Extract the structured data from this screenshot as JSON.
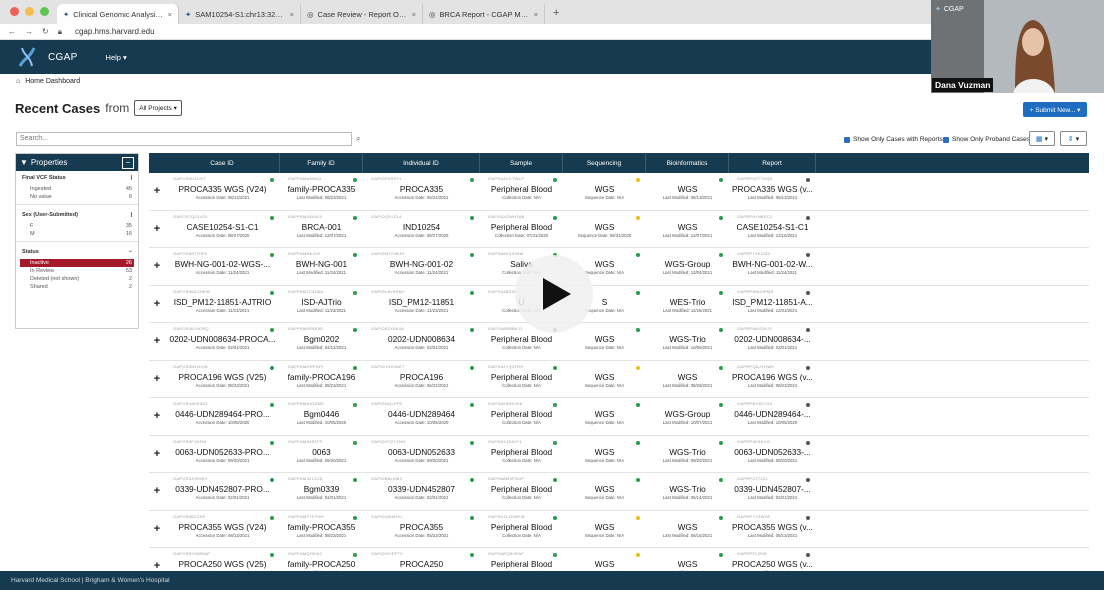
{
  "browser": {
    "tabs": [
      {
        "label": "Clinical Genomic Analysis Platf",
        "active": true
      },
      {
        "label": "SAM10254-S1:chr13:32316529"
      },
      {
        "label": "Case Review - Report Overview"
      },
      {
        "label": "BRCA Report - CGAP Mockup"
      }
    ],
    "url": "cgap.hms.harvard.edu"
  },
  "nav": {
    "brand": "CGAP",
    "help": "Help ▾"
  },
  "breadcrumb": "Home Dashboard",
  "header": {
    "title": "Recent Cases",
    "from": "from",
    "project_select": "All Projects ▾",
    "submit": "+ Submit New... ▾"
  },
  "search": {
    "placeholder": "Search..."
  },
  "options": {
    "reports": "Show Only Cases with Reports",
    "proband": "Show Only Proband Cases"
  },
  "facets": {
    "title": "Properties",
    "groups": [
      {
        "title": "Final VCF Status",
        "items": [
          {
            "label": "Ingested",
            "count": "45"
          },
          {
            "label": "No value",
            "count": "6"
          }
        ]
      },
      {
        "title": "Sex (User-Submitted)",
        "items": [
          {
            "label": "F",
            "count": "35"
          },
          {
            "label": "M",
            "count": "16"
          }
        ]
      },
      {
        "title": "Status",
        "items": [
          {
            "label": "Inactive",
            "count": "26",
            "selected": true
          },
          {
            "label": "In Review",
            "count": "53"
          },
          {
            "label": "Deleted (not shown)",
            "count": "2"
          },
          {
            "label": "Shared",
            "count": "2"
          }
        ]
      }
    ]
  },
  "table": {
    "columns": [
      "Case ID",
      "Family ID",
      "Individual ID",
      "Sample",
      "Sequencing",
      "Bioinformatics",
      "Report"
    ],
    "rows": [
      {
        "case": "PROCA335 WGS (V24)",
        "case_acc": "GAPCR6U1CZT",
        "case_date": "Accession Date: 08/13/2021",
        "family": "family-PROCA335",
        "fam_acc": "GAPFAMU0D6Q",
        "fam_date": "Last Modified: 08/23/2021",
        "ind": "PROCA335",
        "ind_acc": "GAPIDP4R9Y1",
        "ind_date": "Accession Date: 06/22/2021",
        "sample": "Peripheral Blood",
        "sample_acc": "GAPSA4VCTWLP",
        "sample_date": "Collection Date: N/A",
        "seq": "WGS",
        "seq_date": "Sequence Date: N/A",
        "bio": "WGS",
        "bio_date": "Last Modified: 08/13/2021",
        "report": "PROCA335 WGS (v...",
        "rep_acc": "GAPRP9ZT7UQ5",
        "rep_date": "Last Modified: 08/13/2021",
        "seq_dot": "#e8c21b"
      },
      {
        "case": "CASE10254-S1-C1",
        "case_acc": "GAPCR7QJ1XOI",
        "case_date": "Accession Date: 08/27/2020",
        "family": "BRCA-001",
        "fam_acc": "GAPFAM43K8L5",
        "fam_date": "Last Modified: 12/07/2021",
        "ind": "IND10254",
        "ind_acc": "GAPIDQ5YZL4",
        "ind_date": "Accession Date: 08/27/2020",
        "sample": "Peripheral Blood",
        "sample_acc": "GAPSAXZWHTAB",
        "sample_date": "Collection Date: 07/31/2020",
        "seq": "WGS",
        "seq_date": "Sequence Date: 08/31/2020",
        "bio": "WGS",
        "bio_date": "Last Modified: 12/07/2021",
        "report": "CASE10254-S1-C1",
        "rep_acc": "GAPRP6YN8PCZ",
        "rep_date": "Last Modified: 12/16/2021",
        "seq_dot": "#e8c21b"
      },
      {
        "case": "BWH-NG-001-02-WGS-...",
        "case_acc": "GAPCR8S77IRG",
        "case_date": "Accession Date: 11/24/2021",
        "family": "BWH-NG-001",
        "fam_acc": "GAPFAMRK3J9",
        "fam_date": "Last Modified: 11/24/2021",
        "ind": "BWH-NG-001-02",
        "ind_acc": "GAPIDN7Y3BJH",
        "ind_date": "Accession Date: 11/24/2021",
        "sample": "Saliva",
        "sample_acc": "GAPSA9VXZ94W",
        "sample_date": "Collection Date: N/A",
        "seq": "WGS",
        "seq_date": "Sequence Date: N/A",
        "bio": "WGS-Group",
        "bio_date": "Last Modified: 12/04/2021",
        "report": "BWH-NG-001-02-W...",
        "rep_acc": "GAPRPT4K2ZDI",
        "rep_date": "Last Modified: 11/24/2021",
        "seq_dot": "#2d9a4e"
      },
      {
        "case": "ISD_PM12-11851-AJTRIO",
        "case_acc": "GAPCR9ML2HKW",
        "case_date": "Accession Date: 11/23/2021",
        "family": "ISD-AJTrio",
        "fam_acc": "GAPFAM7C4D8A",
        "fam_date": "Last Modified: 11/23/2021",
        "ind": "ISD_PM12-11851",
        "ind_acc": "GAPIDL8V9RMY",
        "ind_date": "Accession Date: 11/23/2021",
        "sample": "U",
        "sample_acc": "GAPSA3BZ5CJ2",
        "sample_date": "Collection Date: N/A",
        "seq": "S",
        "seq_date": "Sequence Date: N/A",
        "bio": "WES-Trio",
        "bio_date": "Last Modified: 11/26/2021",
        "report": "ISD_PM12-11851-A...",
        "rep_acc": "GAPRP8NU5PMR",
        "rep_date": "Last Modified: 12/01/2021",
        "seq_dot": "#2d9a4e"
      },
      {
        "case": "0202-UDN008634-PROCA...",
        "case_acc": "GAPCR4KJ9CRQ",
        "case_date": "Accession Date: 02/01/2021",
        "family": "Bgm0202",
        "fam_acc": "GAPFAM0R9E8D",
        "fam_date": "Last Modified: 02/12/2021",
        "ind": "0202-UDN008634",
        "ind_acc": "GAPID5ZX9K4A",
        "ind_date": "Accession Date: 02/01/2021",
        "sample": "Peripheral Blood",
        "sample_acc": "GAPSA8RBBKJ1",
        "sample_date": "Collection Date: N/A",
        "seq": "WGS",
        "seq_date": "Sequence Date: N/A",
        "bio": "WGS-Trio",
        "bio_date": "Last Modified: 10/05/2021",
        "report": "0202-UDN008634-...",
        "rep_acc": "GAPRPMK0ZKJY",
        "rep_date": "Last Modified: 02/01/2021",
        "seq_dot": "#2d9a4e"
      },
      {
        "case": "PROCA196 WGS (V25)",
        "case_acc": "GAPCR5MHJOI8",
        "case_date": "Accession Date: 08/23/2021",
        "family": "family-PROCA196",
        "fam_acc": "GAPFAMHHPGFI",
        "fam_date": "Last Modified: 08/23/2021",
        "ind": "PROCA196",
        "ind_acc": "GAPIDY4V9AKT",
        "ind_date": "Accession Date: 06/22/2021",
        "sample": "Peripheral Blood",
        "sample_acc": "GAPSAJYQ3TH9",
        "sample_date": "Collection Date: N/A",
        "seq": "WGS",
        "seq_date": "Sequence Date: N/A",
        "bio": "WGS",
        "bio_date": "Last Modified: 08/28/2021",
        "report": "PROCA196 WGS (v...",
        "rep_acc": "GAPRPQAJYHWK",
        "rep_date": "Last Modified: 08/23/2021",
        "seq_dot": "#e8c21b"
      },
      {
        "case": "0446-UDN289464-PRO...",
        "case_acc": "GAPCR4AKE86Z",
        "case_date": "Accession Date: 10/05/2020",
        "family": "Bgm0446",
        "fam_acc": "GAPFAMAX5ZMZ",
        "fam_date": "Last Modified: 10/05/2020",
        "ind": "0446-UDN289464",
        "ind_acc": "GAPIDNQLFF5",
        "ind_date": "Accession Date: 10/05/2020",
        "sample": "Peripheral Blood",
        "sample_acc": "GAPSA93HK2K8",
        "sample_date": "Collection Date: N/A",
        "seq": "WGS",
        "seq_date": "Sequence Date: N/A",
        "bio": "WGS-Group",
        "bio_date": "Last Modified: 10/07/2021",
        "report": "0446-UDN289464-...",
        "rep_acc": "GAPRPBY6CY24",
        "rep_date": "Last Modified: 10/05/2020",
        "seq_dot": "#2d9a4e"
      },
      {
        "case": "0063-UDN052633-PRO...",
        "case_acc": "GAPCR5F16J94",
        "case_date": "Accession Date: 09/20/2021",
        "family": "0063",
        "fam_acc": "GAPFAM3X5TFF",
        "fam_date": "Last Modified: 09/20/2021",
        "ind": "0063-UDN052633",
        "ind_acc": "GAPIDSTZYZNG",
        "ind_date": "Accession Date: 09/20/2021",
        "sample": "Peripheral Blood",
        "sample_acc": "GAPSAX12A0T1",
        "sample_date": "Collection Date: N/A",
        "seq": "WGS",
        "seq_date": "Sequence Date: N/A",
        "bio": "WGS-Trio",
        "bio_date": "Last Modified: 09/20/2021",
        "report": "0063-UDN052633-...",
        "rep_acc": "GAPRP3K3AGG",
        "rep_date": "Last Modified: 09/20/2021",
        "seq_dot": "#2d9a4e"
      },
      {
        "case": "0339-UDN452807-PRO...",
        "case_acc": "GAPCR4J0R9KV",
        "case_date": "Accession Date: 02/01/2021",
        "family": "Bgm0339",
        "fam_acc": "GAPFAM321JCB",
        "fam_date": "Last Modified: 02/01/2021",
        "ind": "0339-UDN452807",
        "ind_acc": "GAPIDB8LKM2",
        "ind_date": "Accession Date: 02/01/2021",
        "sample": "Peripheral Blood",
        "sample_acc": "GAPSA8MVF5OP",
        "sample_date": "Collection Date: N/A",
        "seq": "WGS",
        "seq_date": "Sequence Date: N/A",
        "bio": "WGS-Trio",
        "bio_date": "Last Modified: 05/14/2021",
        "report": "0339-UDN452807-...",
        "rep_acc": "GAPRP4T7JZJ",
        "rep_date": "Last Modified: 02/01/2021",
        "seq_dot": "#2d9a4e"
      },
      {
        "case": "PROCA355 WGS (V24)",
        "case_acc": "GAPCR6BZZ5S",
        "case_date": "Accession Date: 08/13/2021",
        "family": "family-PROCA355",
        "fam_acc": "GAPFAM7YFYHH",
        "fam_date": "Last Modified: 08/23/2021",
        "ind": "PROCA355",
        "ind_acc": "GAPIDQBAHXL",
        "ind_date": "Accession Date: 06/22/2021",
        "sample": "Peripheral Blood",
        "sample_acc": "GAPSA7L1DWFW",
        "sample_date": "Collection Date: N/A",
        "seq": "WGS",
        "seq_date": "Sequence Date: N/A",
        "bio": "WGS",
        "bio_date": "Last Modified: 08/16/2021",
        "report": "PROCA355 WGS (v...",
        "rep_acc": "GAPRP7Y3WOF",
        "rep_date": "Last Modified: 08/13/2021",
        "seq_dot": "#e8c21b"
      },
      {
        "case": "PROCA250 WGS (V25)",
        "case_acc": "GAPCR5YXWBAP",
        "case_date": "Accession Date: 08/13/2021",
        "family": "family-PROCA250",
        "fam_acc": "GAPFAMQODAC",
        "fam_date": "Last Modified: 08/23/2021",
        "ind": "PROCA250",
        "ind_acc": "GAPIDGOFPT0",
        "ind_date": "Accession Date: 06/22/2021",
        "sample": "Peripheral Blood",
        "sample_acc": "GAPSARQ9VEAF",
        "sample_date": "Collection Date: N/A",
        "seq": "WGS",
        "seq_date": "Sequence Date: N/A",
        "bio": "WGS",
        "bio_date": "Last Modified: 08/16/2021",
        "report": "PROCA250 WGS (v...",
        "rep_acc": "GAPRPFL2DN",
        "rep_date": "Last Modified: 08/13/2021",
        "seq_dot": "#e8c21b"
      }
    ]
  },
  "footer": "Harvard Medical School  |  Brigham & Women's Hospital",
  "video": {
    "label": "CGAP",
    "name": "Dana Vuzman"
  },
  "colors": {
    "navy": "#163b50",
    "accent": "#1e6dc1",
    "selected": "#a51a2a",
    "status_green": "#2d9a4e",
    "status_yellow": "#e8c21b"
  }
}
